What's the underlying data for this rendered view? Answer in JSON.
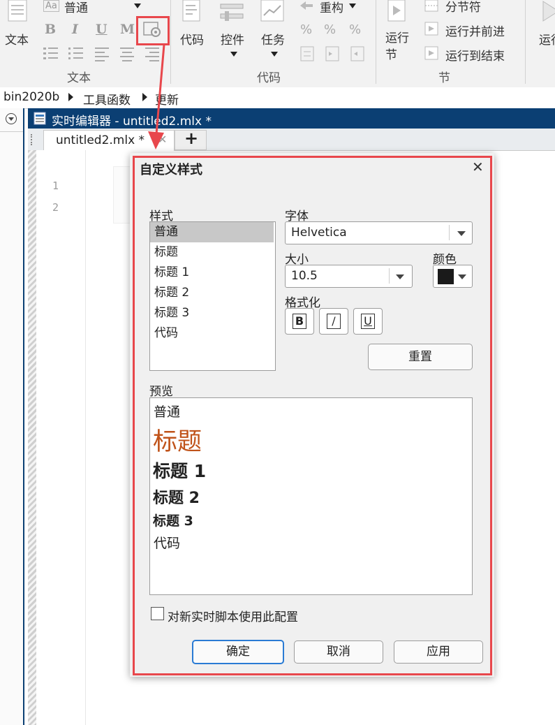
{
  "ribbon": {
    "text_group": {
      "text_button": "文本",
      "style_select": "普通",
      "bold": "B",
      "italic": "I",
      "underline": "U",
      "monospace": "M",
      "group_label": "文本"
    },
    "code_group": {
      "code_button": "代码",
      "control_button": "控件",
      "task_button": "任务",
      "refactor_button": "重构",
      "group_label": "代码"
    },
    "section_group": {
      "run_section": "运行节",
      "section_break": "分节符",
      "run_and_advance": "运行并前进",
      "run_to_end": "运行到结束",
      "group_label": "节"
    },
    "run_button_partial": "运行"
  },
  "breadcrumb": [
    "bin2020b",
    "工具函数",
    "更新"
  ],
  "editor": {
    "title": "实时编辑器 - untitled2.mlx *",
    "tab_label": "untitled2.mlx *",
    "add_tab": "+",
    "line_numbers": [
      "1",
      "2"
    ]
  },
  "dialog": {
    "title": "自定义样式",
    "close": "✕",
    "style_label": "样式",
    "styles": [
      "普通",
      "标题",
      "标题 1",
      "标题 2",
      "标题 3",
      "代码"
    ],
    "selected_style": "普通",
    "font_label": "字体",
    "font_value": "Helvetica",
    "size_label": "大小",
    "size_value": "10.5",
    "color_label": "颜色",
    "color_value": "#1a1a1a",
    "format_label": "格式化",
    "format_buttons": [
      "B",
      "I",
      "U"
    ],
    "reset_button": "重置",
    "preview_label": "预览",
    "preview_lines": [
      "普通",
      "标题",
      "标题 1",
      "标题 2",
      "标题 3",
      "代码"
    ],
    "heading_color": "#c0531a",
    "checkbox_label": "对新实时脚本使用此配置",
    "ok_button": "确定",
    "cancel_button": "取消",
    "apply_button": "应用"
  },
  "annotation": {
    "color": "#e8474c"
  }
}
